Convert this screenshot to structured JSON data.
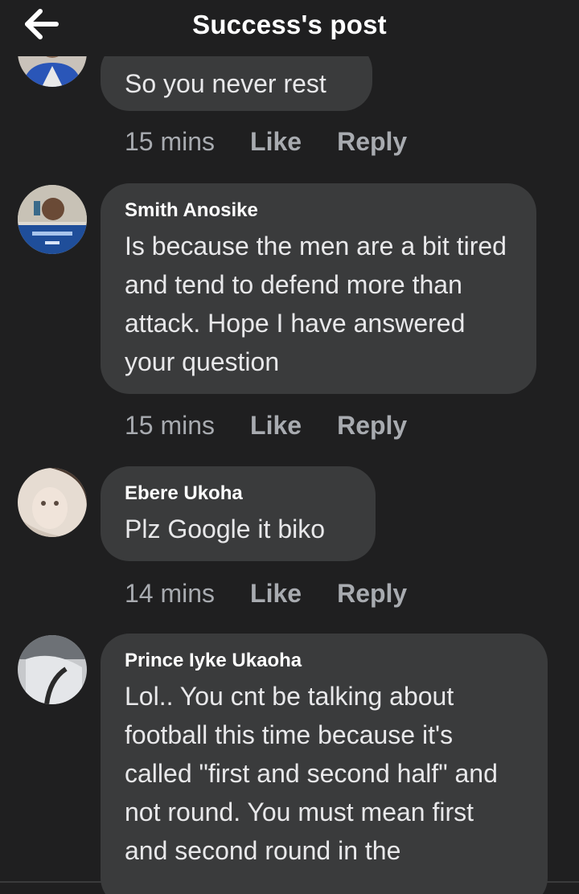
{
  "header": {
    "back_icon": "arrow-left-icon",
    "title": "Success's post"
  },
  "comments": [
    {
      "author": "",
      "text": "So you never rest",
      "time": "15 mins",
      "like": "Like",
      "reply": "Reply"
    },
    {
      "author": "Smith Anosike",
      "text": "Is because the men are a bit tired and tend to defend more than attack. Hope I have answered your question",
      "time": "15 mins",
      "like": "Like",
      "reply": "Reply"
    },
    {
      "author": "Ebere Ukoha",
      "text": "Plz Google it biko",
      "time": "14 mins",
      "like": "Like",
      "reply": "Reply"
    },
    {
      "author": "Prince Iyke Ukaoha",
      "text": "Lol.. You cnt be talking about football this time because it's called \"first and second half\" and not round. You must mean first and second round in the",
      "time": "",
      "like": "",
      "reply": ""
    }
  ],
  "colors": {
    "background": "#1f1f20",
    "bubble": "#3a3b3c",
    "meta_text": "#a8abb0"
  }
}
